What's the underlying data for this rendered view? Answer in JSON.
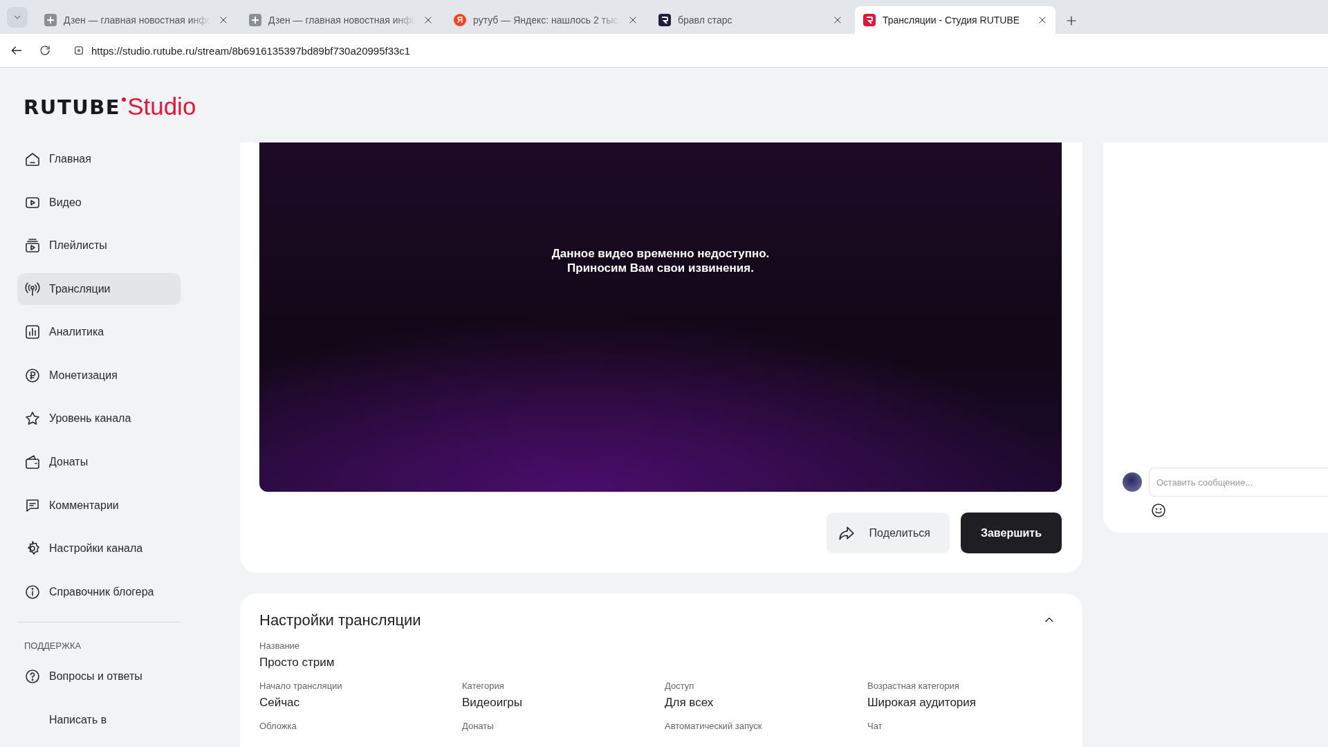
{
  "browser": {
    "tabs": [
      {
        "title": "Дзен — главная новостная инфо",
        "kind": "dzen",
        "selected": false
      },
      {
        "title": "Дзен — главная новостная инфо",
        "kind": "dzen",
        "selected": false
      },
      {
        "title": "рутуб — Яндекс: нашлось 2 тыс.",
        "kind": "yandex",
        "favicon_text": "Я",
        "selected": false
      },
      {
        "title": "бравл старс",
        "kind": "rutube",
        "selected": false
      },
      {
        "title": "Трансляции - Студия RUTUBE",
        "kind": "studio",
        "selected": true
      }
    ],
    "url": "https://studio.rutube.ru/stream/8b6916135397bd89bf730a20995f33c1"
  },
  "logo": {
    "brand": "RUTUBE",
    "product": "Studio"
  },
  "sidebar": {
    "items": [
      {
        "label": "Главная",
        "selected": false
      },
      {
        "label": "Видео",
        "selected": false
      },
      {
        "label": "Плейлисты",
        "selected": false
      },
      {
        "label": "Трансляции",
        "selected": true
      },
      {
        "label": "Аналитика",
        "selected": false
      },
      {
        "label": "Монетизация",
        "selected": false
      },
      {
        "label": "Уровень канала",
        "selected": false
      },
      {
        "label": "Донаты",
        "selected": false
      },
      {
        "label": "Комментарии",
        "selected": false
      },
      {
        "label": "Настройки канала",
        "selected": false
      },
      {
        "label": "Справочник блогера",
        "selected": false
      }
    ],
    "support_heading": "ПОДДЕРЖКА",
    "support_items": [
      {
        "label": "Вопросы и ответы",
        "selected": false
      },
      {
        "label": "Написать в",
        "selected": false
      }
    ]
  },
  "player": {
    "message": [
      "Данное видео временно недоступно.",
      "Приносим Вам свои извинения."
    ]
  },
  "actions": {
    "share": "Поделиться",
    "finish": "Завершить"
  },
  "chat": {
    "placeholder": "Оставить сообщение..."
  },
  "settings": {
    "title": "Настройки трансляции",
    "expanded": true,
    "name": {
      "label": "Название",
      "value": "Просто стрим"
    },
    "fields": [
      {
        "label": "Начало трансляции",
        "value": "Сейчас"
      },
      {
        "label": "Категория",
        "value": "Видеоигры"
      },
      {
        "label": "Доступ",
        "value": "Для всех"
      },
      {
        "label": "Возрастная категория",
        "value": "Широкая аудитория"
      },
      {
        "label": "Обложка"
      },
      {
        "label": "Донаты"
      },
      {
        "label": "Автоматический запуск"
      },
      {
        "label": "Чат"
      }
    ]
  }
}
